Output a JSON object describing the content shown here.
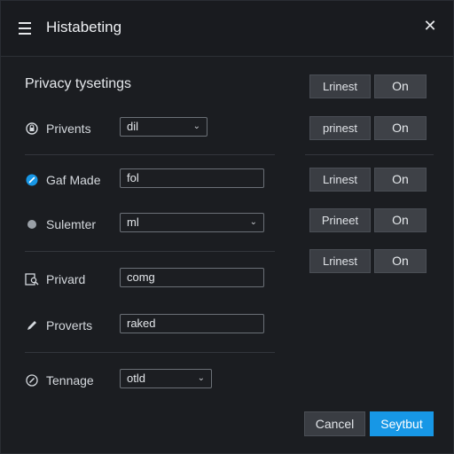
{
  "window": {
    "title": "Histabeting"
  },
  "section": {
    "title": "Privacy tysetings"
  },
  "settings": [
    {
      "label": "Privents",
      "value": "dil",
      "icon": "lock-circle-icon",
      "control": "select"
    },
    {
      "label": "Gaf Made",
      "value": "fol",
      "icon": "blue-check-circle-icon",
      "control": "input"
    },
    {
      "label": "Sulemter",
      "value": "ml",
      "icon": "dot-circle-icon",
      "control": "select"
    },
    {
      "label": "Privard",
      "value": "comg",
      "icon": "search-doc-icon",
      "control": "input"
    },
    {
      "label": "Proverts",
      "value": "raked",
      "icon": "pencil-icon",
      "control": "input"
    },
    {
      "label": "Tennage",
      "value": "otld",
      "icon": "compass-icon",
      "control": "select"
    }
  ],
  "toggles": [
    {
      "name": "Lrinest",
      "state": "On"
    },
    {
      "name": "prinest",
      "state": "On"
    },
    {
      "name": "Lrinest",
      "state": "On"
    },
    {
      "name": "Prineet",
      "state": "On"
    },
    {
      "name": "Lrinest",
      "state": "On"
    }
  ],
  "footer": {
    "cancel_label": "Cancel",
    "primary_label": "Seytbut"
  },
  "colors": {
    "background": "#1b1d21",
    "accent": "#1797e6",
    "button": "#3a3d43",
    "text": "#d7dbe0"
  }
}
